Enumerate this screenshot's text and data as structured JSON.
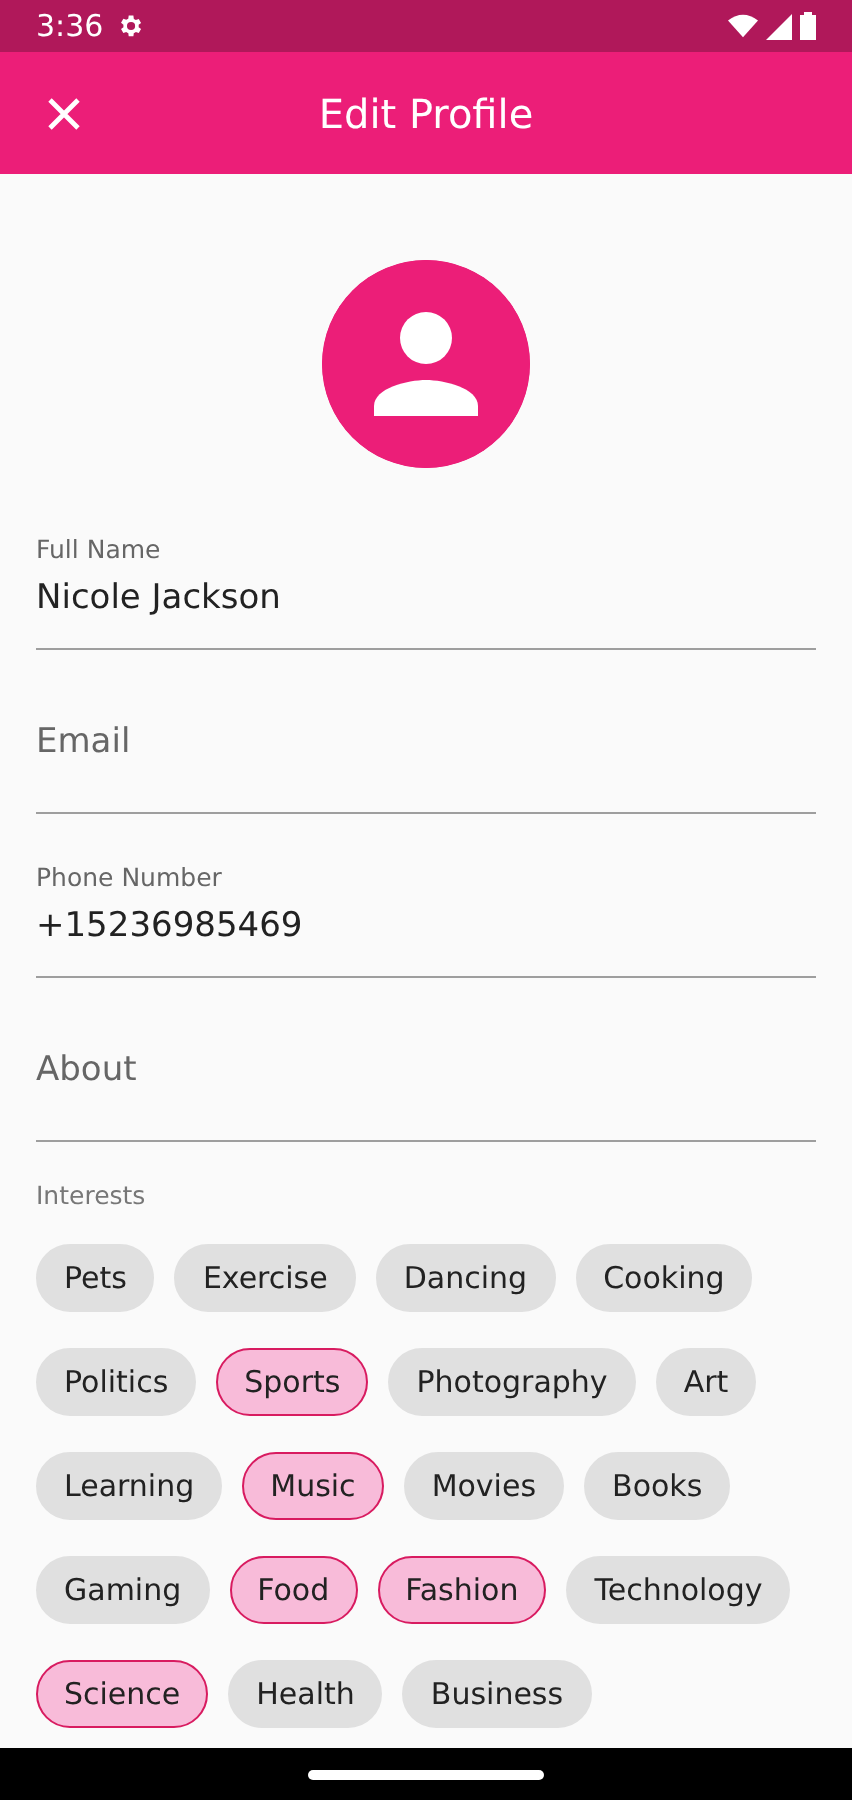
{
  "status_bar": {
    "time": "3:36"
  },
  "app_bar": {
    "title": "Edit Profile"
  },
  "fields": [
    {
      "label": "Full Name",
      "value": "Nicole Jackson"
    },
    {
      "placeholder": "Email"
    },
    {
      "label": "Phone Number",
      "value": "+15236985469"
    },
    {
      "placeholder": "About"
    }
  ],
  "interests": {
    "label": "Interests",
    "chips": [
      {
        "label": "Pets",
        "selected": false
      },
      {
        "label": "Exercise",
        "selected": false
      },
      {
        "label": "Dancing",
        "selected": false
      },
      {
        "label": "Cooking",
        "selected": false
      },
      {
        "label": "Politics",
        "selected": false
      },
      {
        "label": "Sports",
        "selected": true
      },
      {
        "label": "Photography",
        "selected": false
      },
      {
        "label": "Art",
        "selected": false
      },
      {
        "label": "Learning",
        "selected": false
      },
      {
        "label": "Music",
        "selected": true
      },
      {
        "label": "Movies",
        "selected": false
      },
      {
        "label": "Books",
        "selected": false
      },
      {
        "label": "Gaming",
        "selected": false
      },
      {
        "label": "Food",
        "selected": true
      },
      {
        "label": "Fashion",
        "selected": true
      },
      {
        "label": "Technology",
        "selected": false
      },
      {
        "label": "Science",
        "selected": true
      },
      {
        "label": "Health",
        "selected": false
      },
      {
        "label": "Business",
        "selected": false
      }
    ]
  }
}
